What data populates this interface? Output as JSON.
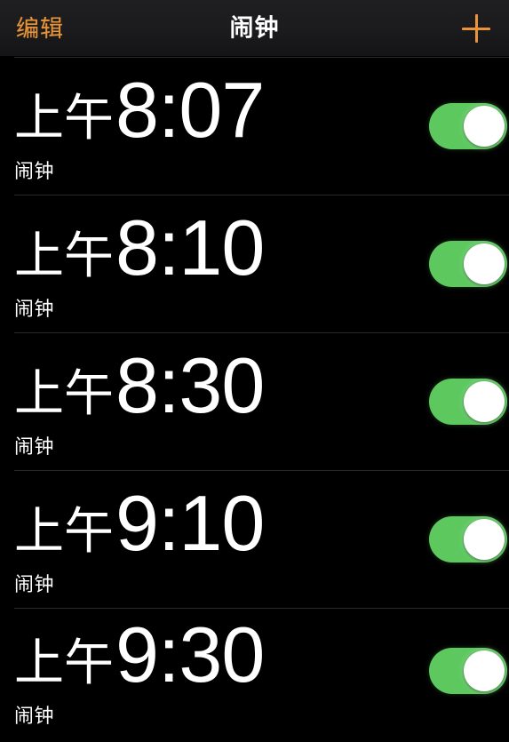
{
  "navbar": {
    "edit_label": "编辑",
    "title": "闹钟",
    "add_icon": "plus-icon",
    "accent_color": "#e8953a",
    "background_color": "#1c1c1e"
  },
  "colors": {
    "screen_background": "#000000",
    "text_primary": "#ffffff",
    "separator": "#2a2a2c",
    "toggle_on": "#5cc85e",
    "toggle_off": "#3a3a3c",
    "toggle_knob": "#ffffff"
  },
  "alarms": [
    {
      "period": "上午",
      "time": "8:07",
      "label": "闹钟",
      "enabled": true,
      "toggle_state": "on"
    },
    {
      "period": "上午",
      "time": "8:10",
      "label": "闹钟",
      "enabled": true,
      "toggle_state": "on"
    },
    {
      "period": "上午",
      "time": "8:30",
      "label": "闹钟",
      "enabled": true,
      "toggle_state": "on"
    },
    {
      "period": "上午",
      "time": "9:10",
      "label": "闹钟",
      "enabled": true,
      "toggle_state": "on"
    },
    {
      "period": "上午",
      "time": "9:30",
      "label": "闹钟",
      "enabled": true,
      "toggle_state": "on"
    }
  ]
}
